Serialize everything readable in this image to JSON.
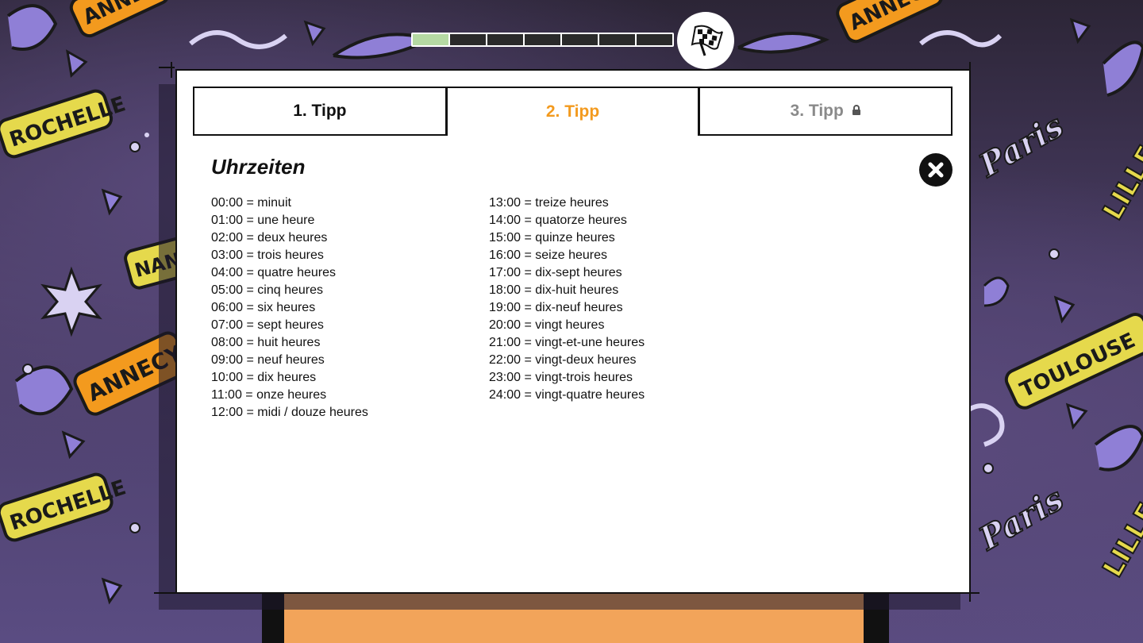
{
  "progress": {
    "segments_total": 7,
    "segments_done": 1,
    "done_color": "#b5d9a3",
    "todo_color": "#2a2a2a",
    "goal_icon": "checkered-flag-icon"
  },
  "tabs": [
    {
      "label": "1. Tipp",
      "state": "normal",
      "color": "#111111"
    },
    {
      "label": "2. Tipp",
      "state": "active",
      "color": "#f39a1e"
    },
    {
      "label": "3. Tipp",
      "state": "locked",
      "color": "#8a8a8a",
      "icon": "lock-icon"
    }
  ],
  "hint": {
    "title": "Uhrzeiten",
    "close_icon": "close-icon",
    "left_column": [
      "00:00 = minuit",
      "01:00 = une heure",
      "02:00 = deux heures",
      "03:00 = trois heures",
      "04:00 = quatre heures",
      "05:00 = cinq heures",
      "06:00 = six heures",
      "07:00 = sept heures",
      "08:00 = huit heures",
      "09:00 = neuf heures",
      "10:00 = dix heures",
      "11:00 = onze heures",
      "12:00 = midi / douze heures"
    ],
    "right_column": [
      "13:00 = treize heures",
      "14:00 = quatorze heures",
      "15:00 = quinze heures",
      "16:00 = seize heures",
      "17:00 = dix-sept heures",
      "18:00 = dix-huit heures",
      "19:00 = dix-neuf heures",
      "20:00 = vingt heures",
      "21:00 = vingt-et-une heures",
      "22:00 = vingt-deux heures",
      "23:00 = vingt-trois heures",
      "24:00 = vingt-quatre heures"
    ]
  },
  "background": {
    "graffiti_words": [
      "ROCHELLE",
      "ANNECY",
      "Paris",
      "TOULOUSE",
      "LILLE",
      "NANTES"
    ],
    "accent_colors": [
      "#f39a1e",
      "#e5d94c",
      "#8f7fd6",
      "#d9d2f2"
    ]
  }
}
